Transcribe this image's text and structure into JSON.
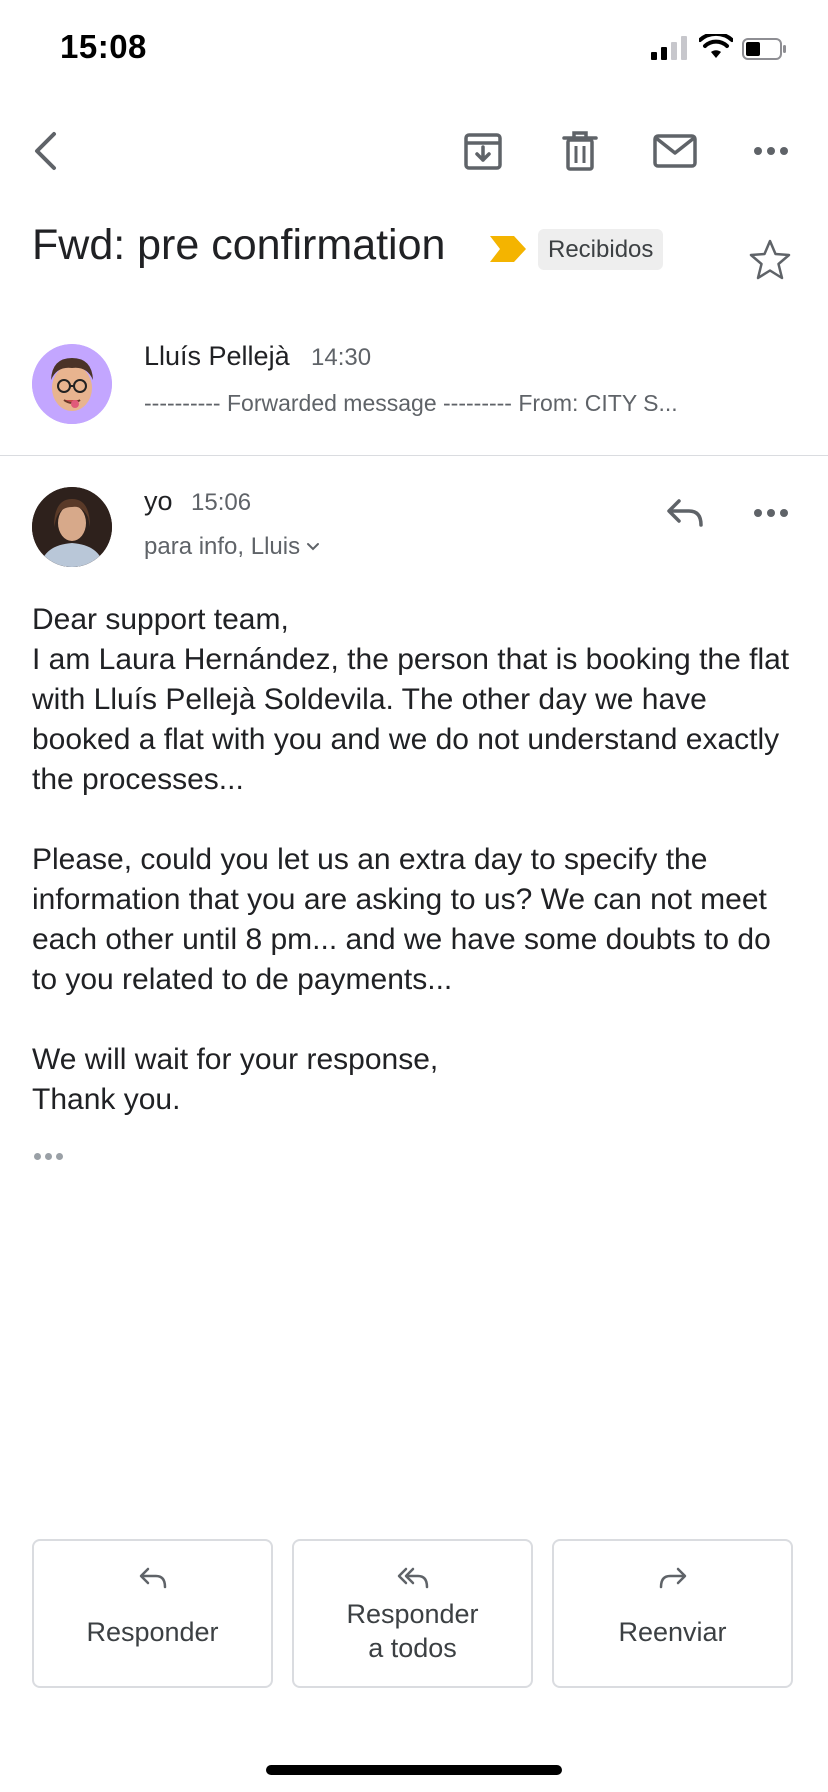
{
  "status_bar": {
    "time": "15:08"
  },
  "toolbar": {
    "back": "back-icon",
    "archive": "archive-icon",
    "delete": "trash-icon",
    "mark_unread": "mail-icon",
    "more": "more-horizontal-icon"
  },
  "subject": {
    "title": "Fwd: pre confirmation",
    "label": "Recibidos",
    "label_color": "#f4b400"
  },
  "messages": [
    {
      "sender": "Lluís Pellejà",
      "time": "14:30",
      "snippet": "---------- Forwarded message --------- From: CITY S...",
      "avatar_bg": "#c3a6ff"
    },
    {
      "sender": "yo",
      "time": "15:06",
      "recipients": "para info, Lluis",
      "body": [
        "Dear support team,\nI am Laura Hernández, the person that is booking the flat with Lluís Pellejà Soldevila. The other day we have booked a flat with you and we do not understand exactly the processes...",
        "Please, could you let us an extra day to specify the information that you are asking to us? We can not meet each other until 8 pm... and we have some doubts to do to you related to de payments...",
        "We will wait for your response,\nThank you."
      ]
    }
  ],
  "actions": {
    "reply": "Responder",
    "reply_all": "Responder\na todos",
    "forward": "Reenviar"
  }
}
